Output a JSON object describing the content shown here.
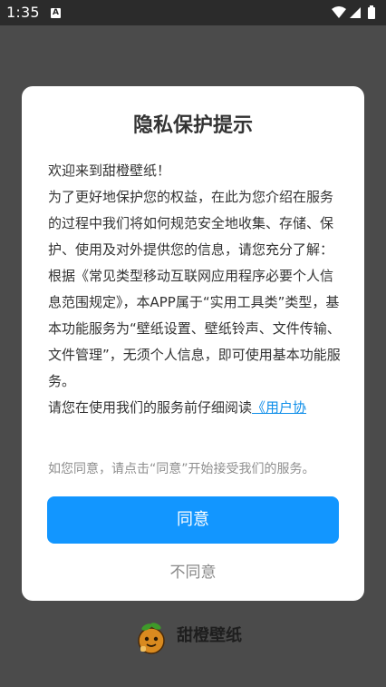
{
  "status_bar": {
    "time": "1:35",
    "notification_icon": "a-letter-icon",
    "notification_letter": "A",
    "right_icons": [
      "wifi-icon",
      "signal-icon",
      "battery-icon"
    ]
  },
  "dialog": {
    "title": "隐私保护提示",
    "paragraphs": [
      "欢迎来到甜橙壁纸！",
      "为了更好地保护您的权益，在此为您介绍在服务的过程中我们将如何规范安全地收集、存储、保护、使用及对外提供您的信息，请您充分了解：",
      "根据《常见类型移动互联网应用程序必要个人信息范围规定》，本APP属于“实用工具类”类型，基本功能服务为“壁纸设置、壁纸铃声、文件传输、文件管理”，无须个人信息，即可使用基本功能服务。"
    ],
    "read_prompt": "请您在使用我们的服务前仔细阅读",
    "agreement_link": "《用户协",
    "consent_note": "如您同意，请点击“同意”开始接受我们的服务。",
    "agree_label": "同意",
    "disagree_label": "不同意"
  },
  "brand": {
    "name": "甜橙壁纸",
    "logo_icon": "orange-mascot-icon"
  },
  "colors": {
    "background": "#4b4b4b",
    "status_bar": "#2b2b2b",
    "accent": "#1296ff",
    "link": "#0e8ee9",
    "muted_text": "#8e8e8e"
  }
}
